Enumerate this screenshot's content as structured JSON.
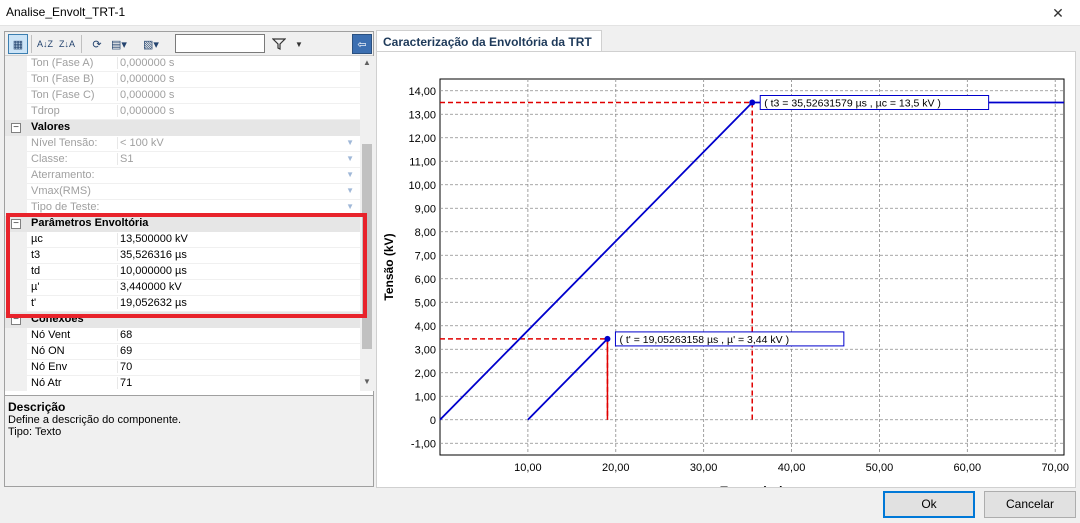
{
  "window": {
    "title": "Analise_Envolt_TRT-1",
    "close": "✕"
  },
  "toolbar": {
    "sort_az": "A↓Z",
    "sort_za": "Z↓A",
    "search_value": ""
  },
  "grid": {
    "rows_top": [
      {
        "name": "Ton (Fase A)",
        "value": "0,000000 s"
      },
      {
        "name": "Ton (Fase B)",
        "value": "0,000000 s"
      },
      {
        "name": "Ton (Fase C)",
        "value": "0,000000 s"
      },
      {
        "name": "Tdrop",
        "value": "0,000000 s"
      }
    ],
    "cat_valores": "Valores",
    "valores": [
      {
        "name": "Nível Tensão:",
        "value": "< 100 kV"
      },
      {
        "name": "Classe:",
        "value": "S1"
      },
      {
        "name": "Aterramento:",
        "value": ""
      },
      {
        "name": "Vmax(RMS)",
        "value": ""
      },
      {
        "name": "Tipo de Teste:",
        "value": ""
      }
    ],
    "cat_parametros": "Parâmetros Envoltória",
    "parametros": [
      {
        "name": "µc",
        "value": "13,500000 kV"
      },
      {
        "name": "t3",
        "value": "35,526316 µs"
      },
      {
        "name": "td",
        "value": "10,000000 µs"
      },
      {
        "name": "µ'",
        "value": "3,440000 kV"
      },
      {
        "name": "t'",
        "value": "19,052632 µs"
      }
    ],
    "cat_conexoes": "Conexões",
    "conexoes": [
      {
        "name": "Nó Vent",
        "value": "68"
      },
      {
        "name": "Nó ON",
        "value": "69"
      },
      {
        "name": "Nó Env",
        "value": "70"
      },
      {
        "name": "Nó Atr",
        "value": "71"
      }
    ]
  },
  "description": {
    "title": "Descrição",
    "line1": "Define a descrição do componente.",
    "line2": "Tipo: Texto"
  },
  "tab": {
    "label": "Caracterização da Envoltória da TRT"
  },
  "buttons": {
    "ok": "Ok",
    "cancel": "Cancelar"
  },
  "chart_data": {
    "type": "line",
    "xlabel": "Tempo (µs)",
    "ylabel": "Tensão (kV)",
    "xlim": [
      0,
      71
    ],
    "ylim": [
      -1.5,
      14.5
    ],
    "x_ticks": [
      "10,00",
      "20,00",
      "30,00",
      "40,00",
      "50,00",
      "60,00",
      "70,00"
    ],
    "x_tick_values": [
      10,
      20,
      30,
      40,
      50,
      60,
      70
    ],
    "y_ticks": [
      "14,00",
      "13,00",
      "12,00",
      "11,00",
      "10,00",
      "9,00",
      "8,00",
      "7,00",
      "6,00",
      "5,00",
      "4,00",
      "3,00",
      "2,00",
      "1,00",
      "0",
      "-1,00"
    ],
    "y_tick_values": [
      14,
      13,
      12,
      11,
      10,
      9,
      8,
      7,
      6,
      5,
      4,
      3,
      2,
      1,
      0,
      -1
    ],
    "grid": true,
    "series": [
      {
        "color": "#0000cc",
        "x": [
          0,
          35.52631579,
          71
        ],
        "y": [
          0,
          13.5,
          13.5
        ]
      },
      {
        "color": "#0000cc",
        "x": [
          10,
          19.05263158
        ],
        "y": [
          0,
          3.44
        ]
      }
    ],
    "markers": [
      {
        "x": 35.52631579,
        "y": 13.5,
        "label": "( t3 = 35,52631579 µs , µc = 13,5 kV )"
      },
      {
        "x": 19.05263158,
        "y": 3.44,
        "label": "( t' = 19,05263158 µs , µ' = 3,44 kV )"
      }
    ],
    "red_color": "#e00000"
  }
}
